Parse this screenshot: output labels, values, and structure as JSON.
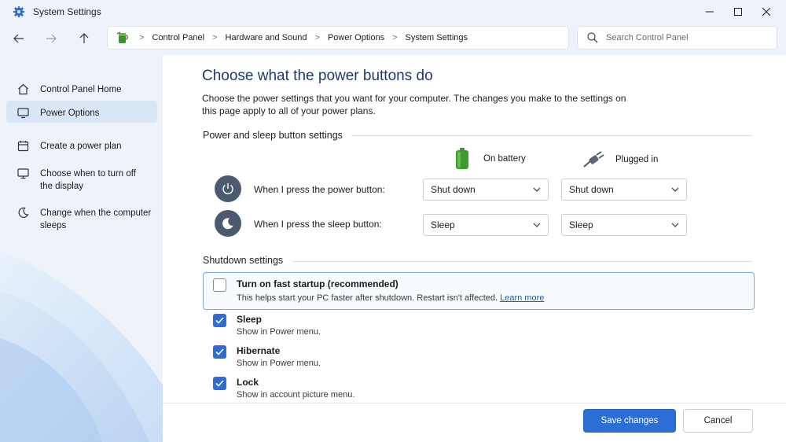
{
  "window": {
    "title": "System Settings",
    "accent": "#2b6fd6"
  },
  "navigation": {
    "breadcrumbs": [
      "Control Panel",
      "Hardware and Sound",
      "Power Options",
      "System Settings"
    ],
    "search_placeholder": "Search Control Panel"
  },
  "sidebar": {
    "items": [
      {
        "label": "Control Panel Home",
        "icon": "home-icon",
        "active": false
      },
      {
        "label": "Power Options",
        "icon": "monitor-icon",
        "active": true
      },
      {
        "label": "Create a power plan",
        "icon": "calendar-icon",
        "active": false
      },
      {
        "label": "Choose when to turn off the display",
        "icon": "display-icon",
        "active": false
      },
      {
        "label": "Change when the computer sleeps",
        "icon": "moon-icon",
        "active": false
      }
    ]
  },
  "main": {
    "title": "Choose what the power buttons do",
    "description": "Choose the power settings that you want for your computer. The changes you make to the settings on this page apply to all of your power plans.",
    "power_section": {
      "heading": "Power and sleep button settings",
      "columns": [
        "On battery",
        "Plugged in"
      ],
      "rows": [
        {
          "label": "When I press the power button:",
          "icon": "power-icon",
          "on_battery": "Shut down",
          "plugged_in": "Shut down"
        },
        {
          "label": "When I press the sleep button:",
          "icon": "sleep-moon-icon",
          "on_battery": "Sleep",
          "plugged_in": "Sleep"
        }
      ]
    },
    "shutdown_section": {
      "heading": "Shutdown settings",
      "fast_startup": {
        "title": "Turn on fast startup (recommended)",
        "description": "This helps start your PC faster after shutdown. Restart isn't affected.",
        "link": "Learn more",
        "checked": false
      },
      "options": [
        {
          "title": "Sleep",
          "description": "Show in Power menu.",
          "checked": true
        },
        {
          "title": "Hibernate",
          "description": "Show in Power menu.",
          "checked": true
        },
        {
          "title": "Lock",
          "description": "Show in account picture menu.",
          "checked": true
        }
      ]
    }
  },
  "footer": {
    "save_label": "Save changes",
    "cancel_label": "Cancel"
  }
}
